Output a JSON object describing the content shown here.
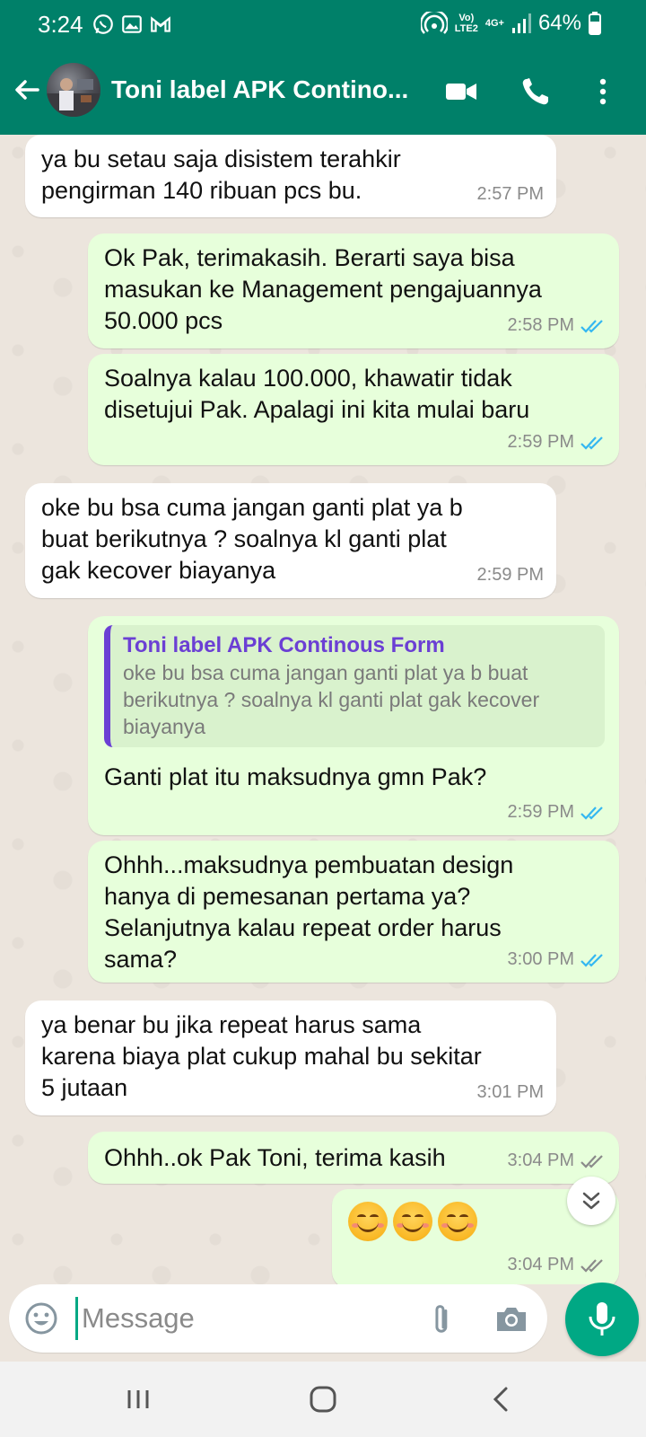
{
  "status_bar": {
    "time": "3:24",
    "network_top": "Vo)",
    "network_bottom": "LTE2",
    "signal_label": "4G+",
    "battery": "64%"
  },
  "header": {
    "contact_name": "Toni label APK Contino...",
    "icons": [
      "back-arrow-icon",
      "video-call-icon",
      "voice-call-icon",
      "more-options-icon"
    ]
  },
  "messages": [
    {
      "direction": "in",
      "text": "ya bu setau saja disistem terahkir\npengirman 140 ribuan pcs bu.",
      "time": "2:57 PM"
    },
    {
      "direction": "out",
      "text": "Ok Pak, terimakasih. Berarti saya bisa\nmasukan ke Management pengajuannya\n50.000 pcs",
      "time": "2:58 PM",
      "status": "read"
    },
    {
      "direction": "out",
      "text": "Soalnya kalau 100.000, khawatir tidak\ndisetujui Pak. Apalagi ini kita mulai baru",
      "time": "2:59 PM",
      "status": "read"
    },
    {
      "direction": "in",
      "text": "oke bu bsa cuma jangan ganti plat ya b\nbuat berikutnya ? soalnya kl ganti plat\ngak kecover biayanya",
      "time": "2:59 PM"
    },
    {
      "direction": "out",
      "quote_name": "Toni label APK Continous Form",
      "quote_text": "oke bu bsa cuma jangan ganti plat ya b buat berikutnya ? soalnya kl ganti plat gak kecover biayanya",
      "text": "Ganti plat itu maksudnya gmn Pak?",
      "time": "2:59 PM",
      "status": "read"
    },
    {
      "direction": "out",
      "text": "Ohhh...maksudnya pembuatan design\nhanya di pemesanan pertama ya?\nSelanjutnya kalau repeat order harus\nsama?",
      "time": "3:00 PM",
      "status": "read"
    },
    {
      "direction": "in",
      "text": "ya benar bu jika repeat harus sama\nkarena biaya plat cukup mahal bu sekitar\n5 jutaan",
      "time": "3:01 PM"
    },
    {
      "direction": "out",
      "text": "Ohhh..ok Pak Toni, terima kasih",
      "time": "3:04 PM",
      "status": "delivered"
    },
    {
      "direction": "out",
      "emoji": "smiling-face-emoji x3",
      "time": "3:04 PM",
      "status": "delivered"
    }
  ],
  "composer": {
    "placeholder": "Message"
  },
  "colors": {
    "header": "#008069",
    "outgoing_bubble": "#e7ffdb",
    "incoming_bubble": "#ffffff",
    "read_ticks": "#34b7f1",
    "accent": "#00a884",
    "quote_bar": "#6b3fd4"
  }
}
